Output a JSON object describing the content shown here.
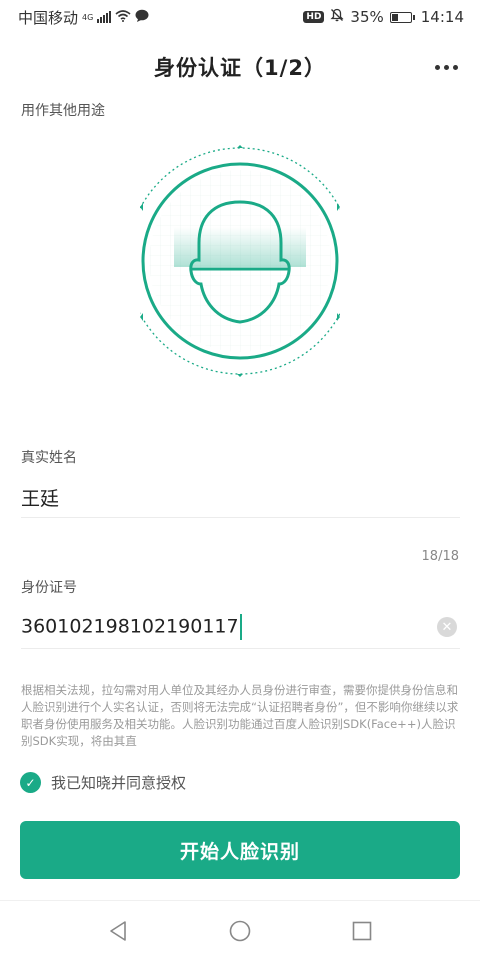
{
  "status_bar": {
    "carrier": "中国移动",
    "network": "4G",
    "battery_percent": "35%",
    "battery_level": 0.35,
    "time": "14:14",
    "hd": "HD",
    "icons": [
      "signal-icon",
      "wifi-icon",
      "message-icon",
      "mute-icon",
      "battery-icon"
    ]
  },
  "header": {
    "title": "身份认证（1/2）",
    "more_icon": "more-dots-icon"
  },
  "purpose_link": "用作其他用途",
  "face_scan": {
    "accent": "#1aaa87",
    "icon": "face-scan-icon"
  },
  "form": {
    "name_label": "真实姓名",
    "name_value": "王廷",
    "counter": "18/18",
    "id_label": "身份证号",
    "id_value": "360102198102190117",
    "clear_icon": "clear-icon"
  },
  "notice": {
    "text": "根据相关法规，拉勾需对用人单位及其经办人员身份进行审查，需要你提供身份信息和人脸识别进行个人实名认证，否则将无法完成“认证招聘者身份”，但不影响你继续以求职者身份使用服务及相关功能。人脸识别功能通过百度人脸识别SDK(Face++)人脸识别SDK实现，将由其直"
  },
  "agreement": {
    "label": "我已知晓并同意授权",
    "checked": true,
    "icon": "check-icon"
  },
  "primary_button": {
    "label": "开始人脸识别"
  },
  "nav_bar": {
    "icons": [
      "back-icon",
      "home-icon",
      "recent-apps-icon"
    ]
  },
  "colors": {
    "accent": "#1aaa87",
    "text": "#222222",
    "muted": "#999999"
  }
}
